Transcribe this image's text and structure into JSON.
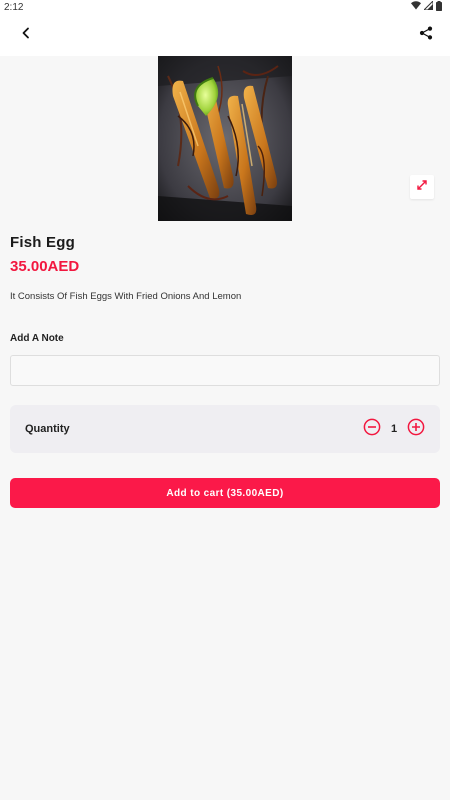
{
  "status_bar": {
    "time": "2:12",
    "icons": [
      "wifi-icon",
      "signal-icon",
      "battery-icon"
    ]
  },
  "app_bar": {
    "back_icon": "back-arrow-icon",
    "share_icon": "share-icon"
  },
  "product": {
    "image_alt": "Fish Egg",
    "name": "Fish Egg",
    "price": "35.00AED",
    "description": "It Consists Of Fish Eggs With Fried Onions And Lemon",
    "expand_icon": "expand-icon"
  },
  "note": {
    "label": "Add A Note",
    "value": "",
    "placeholder": ""
  },
  "quantity": {
    "label": "Quantity",
    "value": "1",
    "minus_icon": "minus-circle-icon",
    "plus_icon": "plus-circle-icon"
  },
  "cart": {
    "button_label": "Add to cart (35.00AED)"
  },
  "colors": {
    "accent": "#fb1949",
    "price": "#f2173f",
    "background": "#f7f7f7",
    "card": "#efeef2"
  }
}
